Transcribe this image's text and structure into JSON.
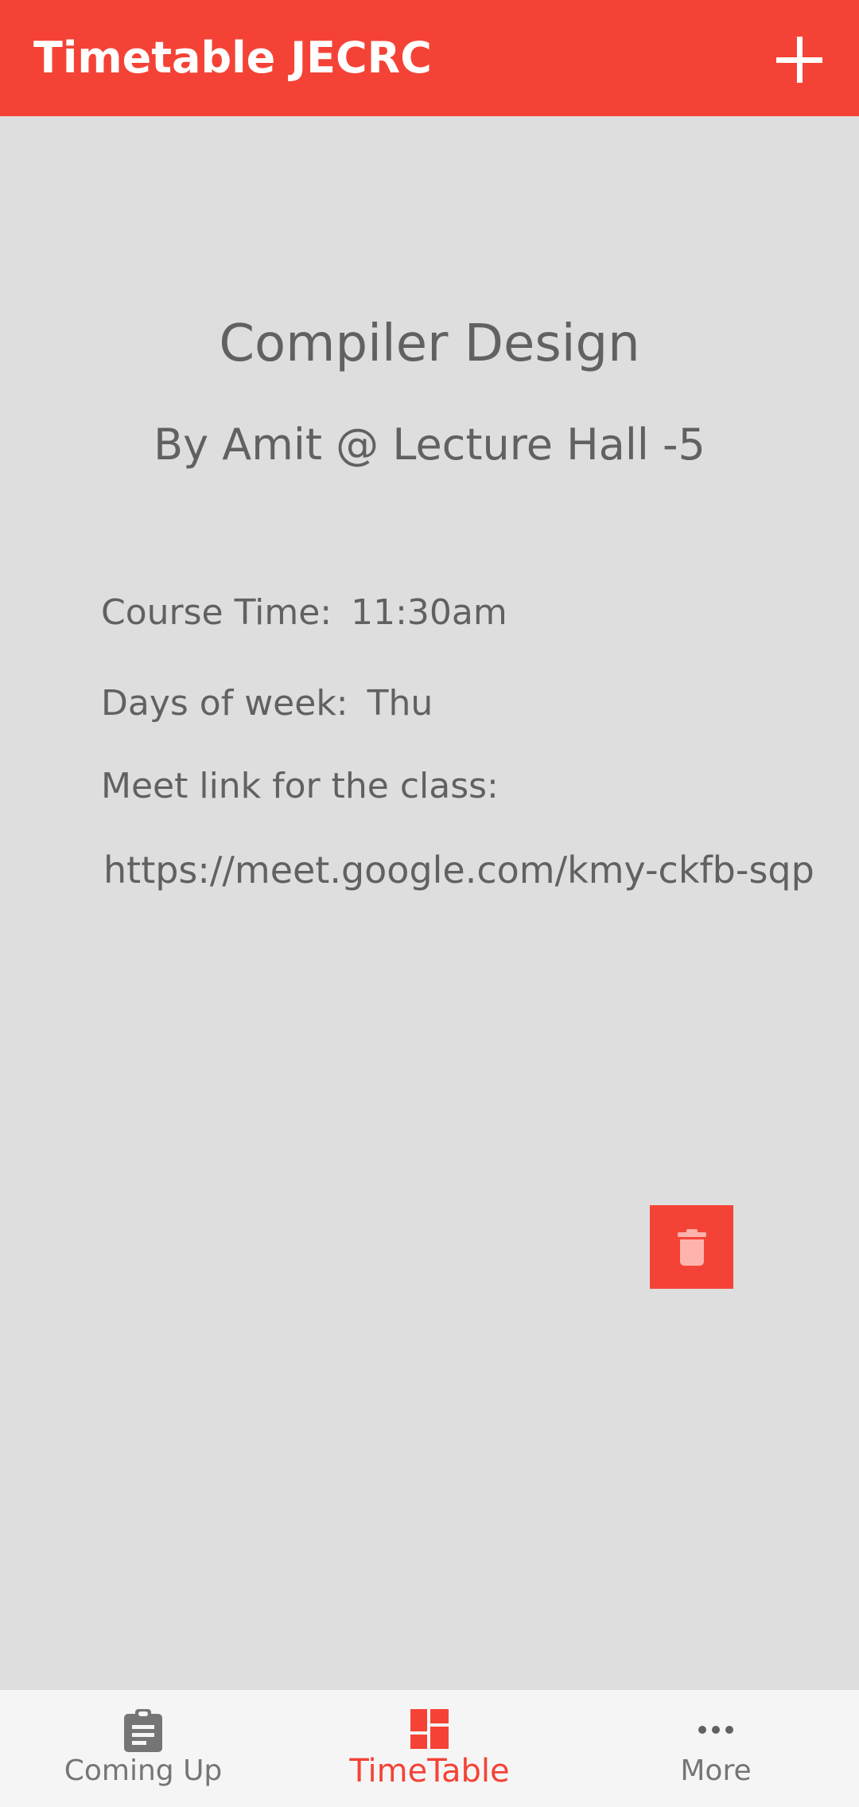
{
  "app": {
    "title": "Timetable JECRC"
  },
  "colors": {
    "accent": "#f44336",
    "background": "#dedede",
    "text": "#616161"
  },
  "course": {
    "name": "Compiler Design",
    "meta": "By Amit @ Lecture Hall -5",
    "time_label": "Course Time:",
    "time_value": "11:30am",
    "days_label": "Days of week:",
    "days_value": "Thu",
    "meet_label": "Meet link for the class:",
    "meet_link": "https://meet.google.com/kmy-ckfb-sqp"
  },
  "icons": {
    "add": "plus-icon",
    "delete": "trash-icon"
  },
  "bottom_nav": {
    "items": [
      {
        "label": "Coming Up",
        "icon": "clipboard-icon",
        "active": false
      },
      {
        "label": "TimeTable",
        "icon": "dashboard-icon",
        "active": true
      },
      {
        "label": "More",
        "icon": "more-horizontal-icon",
        "active": false
      }
    ]
  }
}
